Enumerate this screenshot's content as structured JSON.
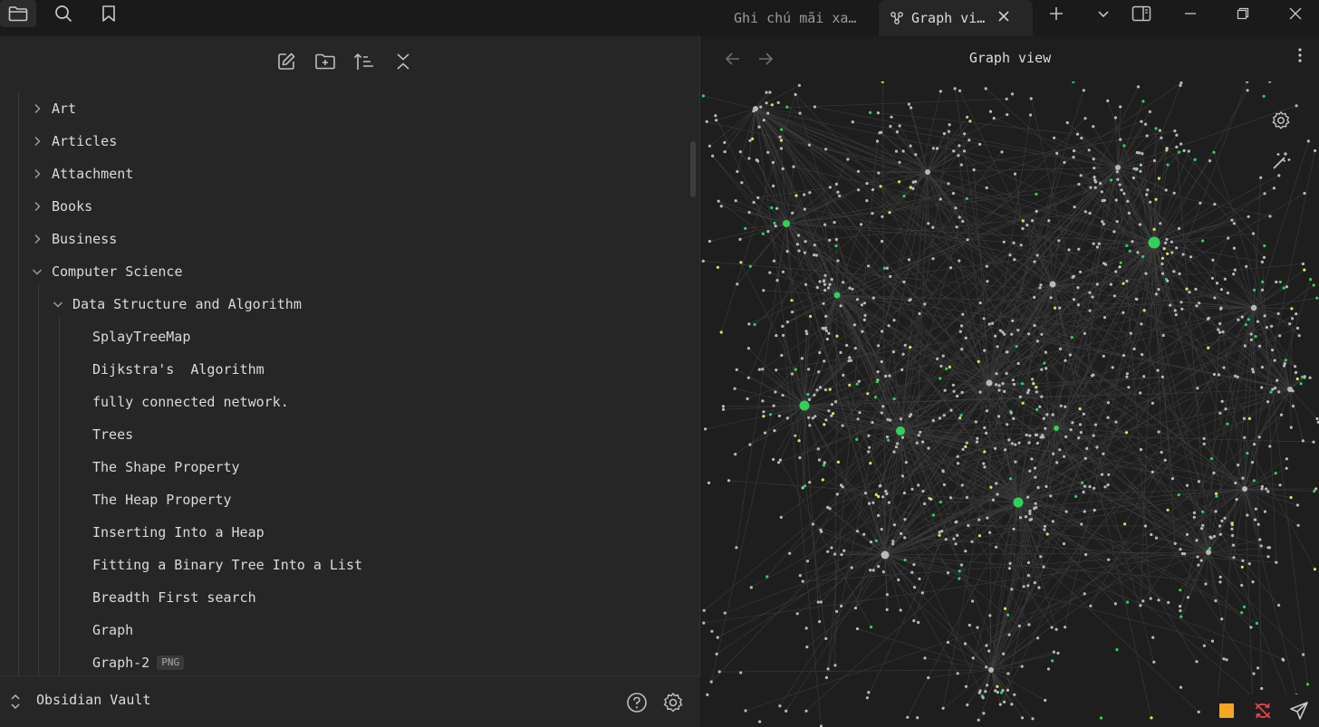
{
  "tabs": [
    {
      "label": "Ghi chú mãi xa…",
      "active": false
    },
    {
      "label": "Graph vi…",
      "active": true
    }
  ],
  "explorer": {
    "items": [
      {
        "label": "Art",
        "depth": 0,
        "type": "folder",
        "expanded": false
      },
      {
        "label": "Articles",
        "depth": 0,
        "type": "folder",
        "expanded": false
      },
      {
        "label": "Attachment",
        "depth": 0,
        "type": "folder",
        "expanded": false
      },
      {
        "label": "Books",
        "depth": 0,
        "type": "folder",
        "expanded": false
      },
      {
        "label": "Business",
        "depth": 0,
        "type": "folder",
        "expanded": false
      },
      {
        "label": "Computer Science",
        "depth": 0,
        "type": "folder",
        "expanded": true
      },
      {
        "label": "Data Structure and Algorithm",
        "depth": 1,
        "type": "folder",
        "expanded": true
      },
      {
        "label": "SplayTreeMap",
        "depth": 2,
        "type": "file"
      },
      {
        "label": "Dijkstra's  Algorithm",
        "depth": 2,
        "type": "file"
      },
      {
        "label": "fully connected network.",
        "depth": 2,
        "type": "file"
      },
      {
        "label": "Trees",
        "depth": 2,
        "type": "file"
      },
      {
        "label": "The Shape Property",
        "depth": 2,
        "type": "file"
      },
      {
        "label": "The Heap Property",
        "depth": 2,
        "type": "file"
      },
      {
        "label": "Inserting Into a Heap",
        "depth": 2,
        "type": "file"
      },
      {
        "label": "Fitting a Binary Tree Into a List",
        "depth": 2,
        "type": "file"
      },
      {
        "label": "Breadth First search",
        "depth": 2,
        "type": "file"
      },
      {
        "label": "Graph",
        "depth": 2,
        "type": "file"
      },
      {
        "label": "Graph-2",
        "depth": 2,
        "type": "file",
        "badge": "PNG"
      }
    ]
  },
  "vault": {
    "name": "Obsidian Vault"
  },
  "graph": {
    "title": "Graph view"
  },
  "colors": {
    "node_default": "#b9b9b9",
    "node_tag": "#30d158",
    "node_attachment": "#d7e36b",
    "edge": "#3c3c3c",
    "status_square": "#f5a623",
    "sync_error": "#e5484d"
  },
  "icons": [
    "folder-icon",
    "search-icon",
    "bookmark-icon",
    "new-note-icon",
    "new-folder-icon",
    "sort-icon",
    "collapse-all-icon",
    "help-icon",
    "settings-icon",
    "wand-icon",
    "send-icon",
    "sync-error-icon"
  ]
}
